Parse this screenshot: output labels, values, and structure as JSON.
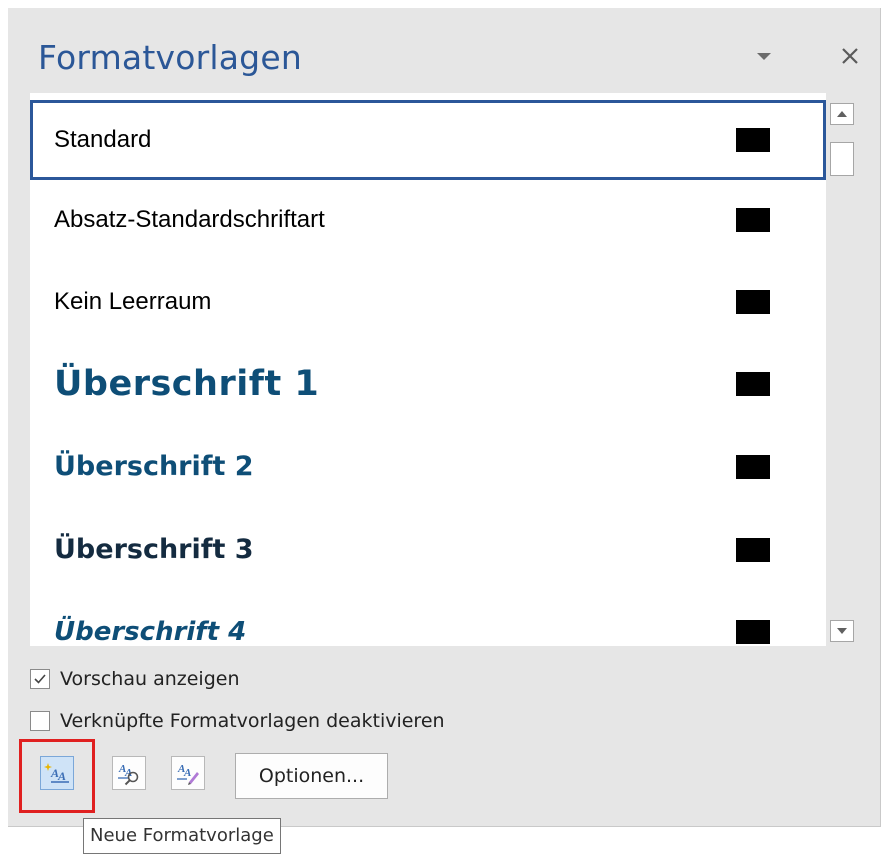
{
  "pane": {
    "title": "Formatvorlagen",
    "menu_icon": "chevron-down-icon",
    "close_icon": "close-icon"
  },
  "styles": {
    "selected_index": 0,
    "items": [
      {
        "label": "Standard"
      },
      {
        "label": "Absatz-Standardschriftart"
      },
      {
        "label": "Kein Leerraum"
      },
      {
        "label": "Überschrift 1"
      },
      {
        "label": "Überschrift 2"
      },
      {
        "label": "Überschrift 3"
      },
      {
        "label": "Überschrift 4"
      }
    ]
  },
  "options": {
    "show_preview": {
      "label": "Vorschau anzeigen",
      "checked": true
    },
    "disable_linked": {
      "label": "Verknüpfte Formatvorlagen deaktivieren",
      "checked": false
    }
  },
  "toolbar": {
    "new_style_icon": "new-style-icon",
    "style_inspector_icon": "style-inspector-icon",
    "manage_styles_icon": "manage-styles-icon",
    "options_label": "Optionen..."
  },
  "tooltip": {
    "text": "Neue Formatvorlage"
  },
  "colors": {
    "title": "#2b5797",
    "selection_border": "#2b579a",
    "heading": "#0e4e77",
    "highlight": "#e02020"
  }
}
